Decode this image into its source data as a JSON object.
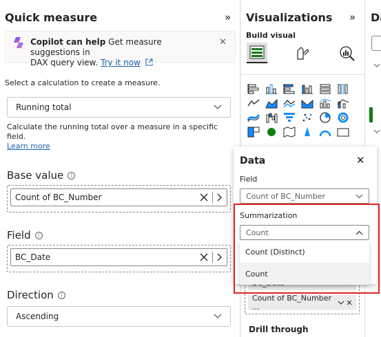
{
  "quick_measure": {
    "title": "Quick measure",
    "collapse_glyph": "»",
    "copilot": {
      "title": "Copilot can help",
      "text_rest": "Get measure suggestions in",
      "text_line2": "DAX query view.",
      "link": "Try it now",
      "close": "✕"
    },
    "select_calc_label": "Select a calculation to create a measure.",
    "calculation": "Running total",
    "calc_description": "Calculate the running total over a measure in a specific field.",
    "learn_more": "Learn more",
    "base_value_label": "Base value",
    "base_value": "Count of BC_Number",
    "field_label": "Field",
    "field_value": "BC_Date",
    "direction_label": "Direction",
    "direction_value": "Ascending",
    "info_glyph": "i"
  },
  "visualizations": {
    "title": "Visualizations",
    "collapse_glyph": "»",
    "build_visual": "Build visual",
    "well_item1": "BC_Date",
    "well_item2": "Count of BC_Number ...",
    "drill_through": "Drill through"
  },
  "data_pane": {
    "title_partial": "Da"
  },
  "data_popup": {
    "title": "Data",
    "close": "✕",
    "field_label": "Field",
    "field_value": "Count of BC_Number",
    "summarization_label": "Summarization",
    "summarization_value": "Count",
    "options": [
      "Count (Distinct)",
      "Count"
    ]
  },
  "colors": {
    "highlight_box": "#e02222",
    "link": "#1a5fb4",
    "selected_option_bg": "#f3f2f1"
  }
}
